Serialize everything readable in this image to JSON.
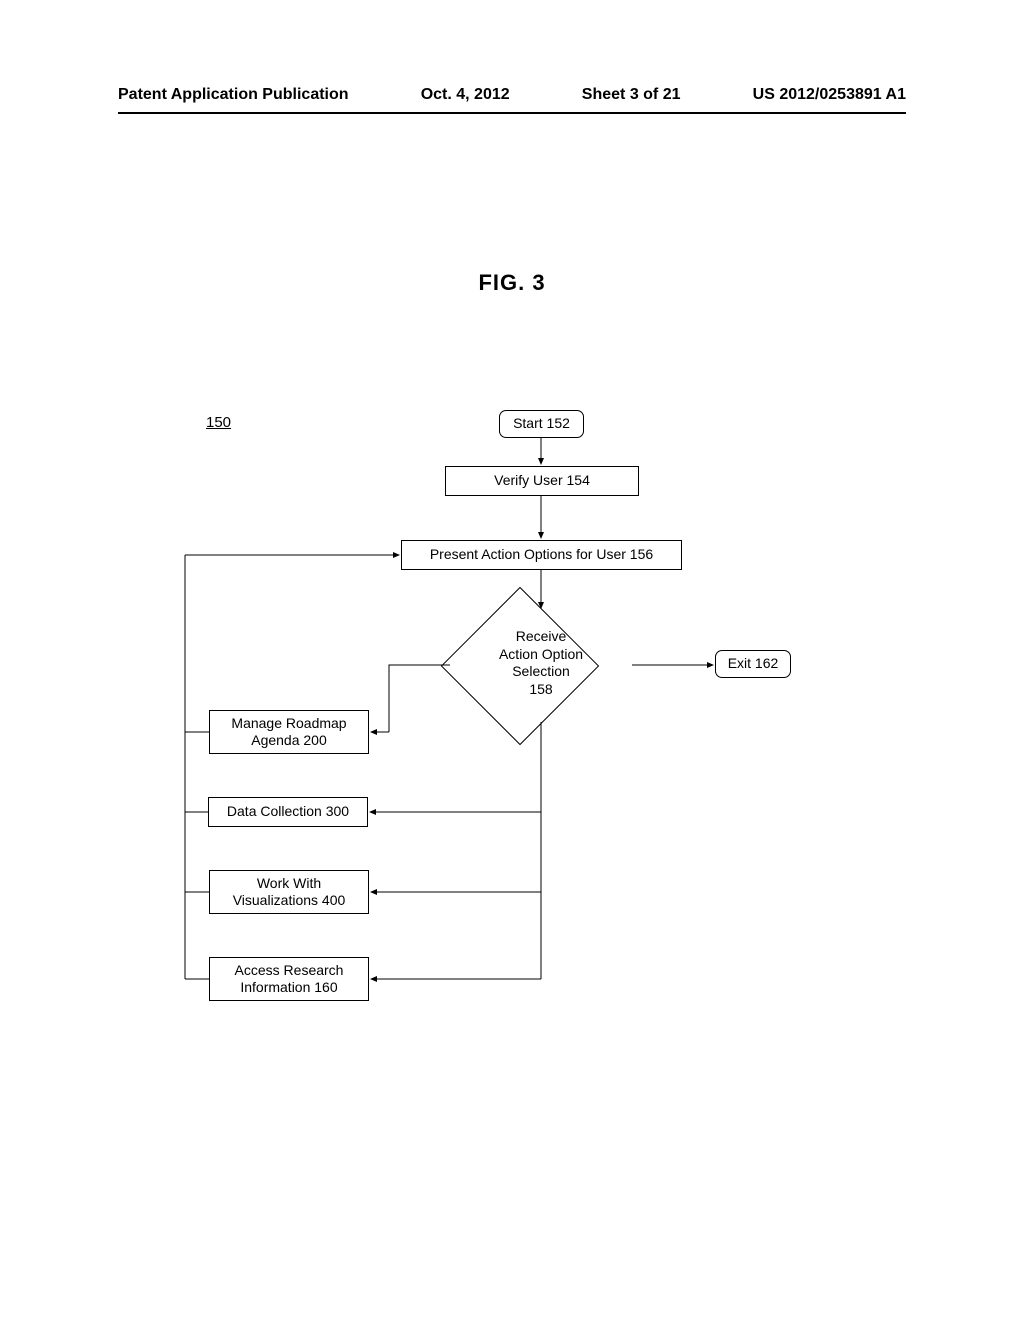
{
  "header": {
    "left": "Patent Application Publication",
    "date": "Oct. 4, 2012",
    "sheet": "Sheet 3 of 21",
    "pubno": "US 2012/0253891 A1"
  },
  "figure_title": "FIG. 3",
  "ref150": "150",
  "nodes": {
    "start": "Start 152",
    "verify": "Verify User 154",
    "present": "Present Action Options for User 156",
    "decision": "Receive\nAction Option\nSelection\n158",
    "exit": "Exit 162",
    "manage": "Manage Roadmap\nAgenda 200",
    "datacoll": "Data Collection 300",
    "workwith": "Work With\nVisualizations 400",
    "access": "Access Research\nInformation 160"
  },
  "chart_data": {
    "type": "flowchart",
    "title": "FIG. 3",
    "reference_numeral": "150",
    "nodes": [
      {
        "id": "152",
        "label": "Start 152",
        "shape": "terminator"
      },
      {
        "id": "154",
        "label": "Verify User 154",
        "shape": "process"
      },
      {
        "id": "156",
        "label": "Present Action Options for User 156",
        "shape": "process"
      },
      {
        "id": "158",
        "label": "Receive Action Option Selection 158",
        "shape": "decision"
      },
      {
        "id": "162",
        "label": "Exit 162",
        "shape": "terminator"
      },
      {
        "id": "200",
        "label": "Manage Roadmap Agenda 200",
        "shape": "process"
      },
      {
        "id": "300",
        "label": "Data Collection 300",
        "shape": "process"
      },
      {
        "id": "400",
        "label": "Work With Visualizations 400",
        "shape": "process"
      },
      {
        "id": "160",
        "label": "Access Research Information 160",
        "shape": "process"
      }
    ],
    "edges": [
      {
        "from": "152",
        "to": "154"
      },
      {
        "from": "154",
        "to": "156"
      },
      {
        "from": "156",
        "to": "158"
      },
      {
        "from": "158",
        "to": "162"
      },
      {
        "from": "158",
        "to": "200"
      },
      {
        "from": "158",
        "to": "300"
      },
      {
        "from": "158",
        "to": "400"
      },
      {
        "from": "158",
        "to": "160"
      },
      {
        "from": "200",
        "to": "156",
        "loopback": true
      },
      {
        "from": "300",
        "to": "156",
        "loopback": true
      },
      {
        "from": "400",
        "to": "156",
        "loopback": true
      },
      {
        "from": "160",
        "to": "156",
        "loopback": true
      }
    ]
  }
}
